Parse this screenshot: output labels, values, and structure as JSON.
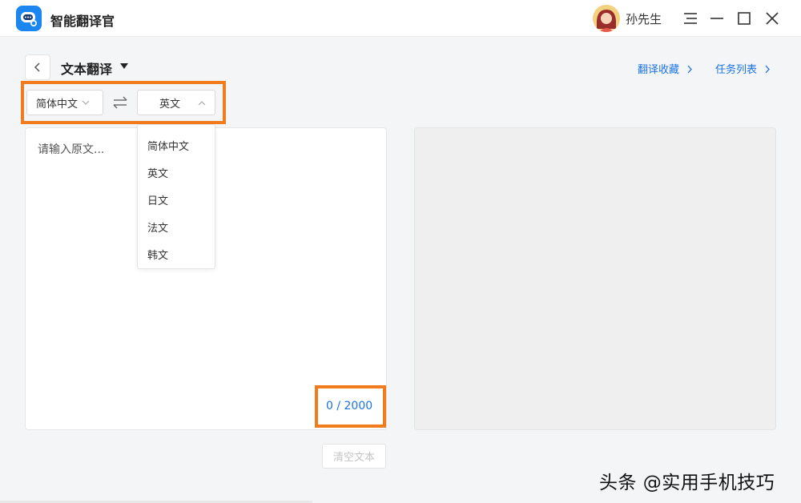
{
  "app": {
    "title": "智能翻译官",
    "username": "孙先生"
  },
  "header": {
    "page_title": "文本翻译",
    "links": [
      "翻译收藏",
      "任务列表"
    ]
  },
  "languages": {
    "source": "简体中文",
    "target": "英文",
    "options": [
      "简体中文",
      "英文",
      "日文",
      "法文",
      "韩文"
    ]
  },
  "input": {
    "placeholder": "请输入原文...",
    "counter": "0 / 2000"
  },
  "buttons": {
    "clear": "清空文本"
  },
  "watermark": "头条 @实用手机技巧",
  "colors": {
    "accent": "#1a73e8",
    "brand": "#1b86f0",
    "highlight": "#f07c1e"
  }
}
